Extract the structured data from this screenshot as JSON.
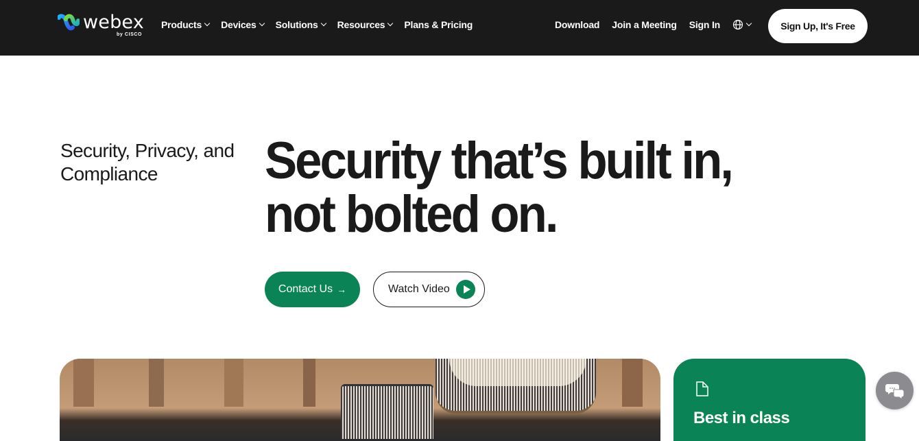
{
  "header": {
    "logo": {
      "name": "webex",
      "sub": "by CISCO"
    },
    "nav_left": [
      {
        "label": "Products",
        "has_dropdown": true
      },
      {
        "label": "Devices",
        "has_dropdown": true
      },
      {
        "label": "Solutions",
        "has_dropdown": true
      },
      {
        "label": "Resources",
        "has_dropdown": true
      },
      {
        "label": "Plans & Pricing",
        "has_dropdown": false
      }
    ],
    "nav_right": [
      {
        "label": "Download"
      },
      {
        "label": "Join a Meeting"
      },
      {
        "label": "Sign In"
      }
    ],
    "language_icon": "globe-icon",
    "signup_label": "Sign Up, It's Free"
  },
  "hero": {
    "section_label": "Security, Privacy, and Compliance",
    "headline_line1": "Security that’s built in,",
    "headline_line2": "not bolted on.",
    "contact_label": "Contact Us",
    "contact_icon": "arrow-right-icon",
    "watch_label": "Watch Video",
    "watch_icon": "play-icon"
  },
  "card": {
    "icon": "document-icon",
    "title": "Best in class"
  },
  "chat": {
    "icon": "chat-bubbles-icon"
  },
  "colors": {
    "nav_bg": "#1a1a1a",
    "accent_green": "#0a8456",
    "text_dark": "#1a1a1a",
    "chat_gray": "#8b8b90"
  }
}
